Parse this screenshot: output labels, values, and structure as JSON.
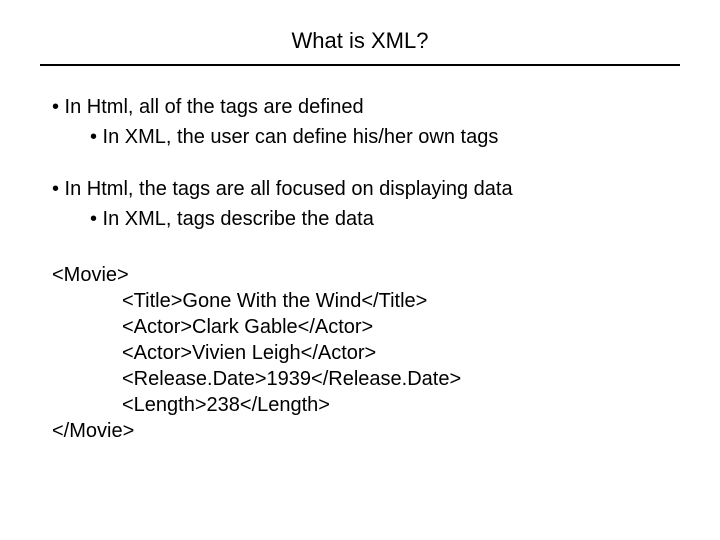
{
  "title": "What is XML?",
  "bullets": {
    "a1": "• In Html, all of the tags are defined",
    "a2": "• In XML, the user can define his/her own tags",
    "b1": "• In Html, the tags are all focused on displaying data",
    "b2": "• In XML, tags describe the data"
  },
  "code": {
    "l1": "<Movie>",
    "l2": "<Title>Gone With the Wind</Title>",
    "l3": "<Actor>Clark Gable</Actor>",
    "l4": "<Actor>Vivien Leigh</Actor>",
    "l5": "<Release.Date>1939</Release.Date>",
    "l6": "<Length>238</Length>",
    "l7": "</Movie>"
  }
}
